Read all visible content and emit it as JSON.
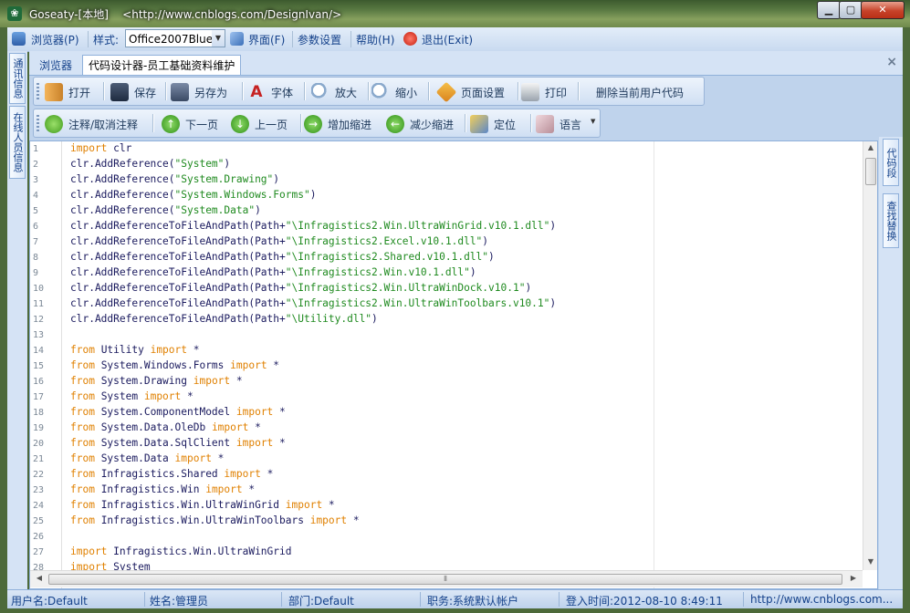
{
  "window": {
    "title": "Goseaty-[本地]    <http://www.cnblogs.com/DesignIvan/>",
    "minimize_glyph": "▁",
    "maximize_glyph": "▢",
    "close_glyph": "✕"
  },
  "menubar": {
    "browser": "浏览器(P)",
    "style_label": "样式:",
    "style_value": "Office2007Blue",
    "interface": "界面(F)",
    "params": "参数设置",
    "help": "帮助(H)",
    "exit": "退出(Exit)"
  },
  "left_tabs": [
    "通讯信息",
    "在线人员信息"
  ],
  "right_tabs": [
    "代码段",
    "查找替换"
  ],
  "doc_tabs": {
    "tabs": [
      "浏览器",
      "代码设计器-员工基础资料维护"
    ],
    "active_index": 1,
    "close_glyph": "×"
  },
  "toolbar1": {
    "open": "打开",
    "save": "保存",
    "save_as": "另存为",
    "font": "字体",
    "zoom_in": "放大",
    "zoom_out": "缩小",
    "page_setup": "页面设置",
    "print": "打印",
    "delete_user_code": "删除当前用户代码"
  },
  "toolbar2": {
    "comment": "注释/取消注释",
    "next_page": "下一页",
    "prev_page": "上一页",
    "indent": "增加缩进",
    "outdent": "减少缩进",
    "locate": "定位",
    "language": "语言"
  },
  "editor": {
    "line_numbers": [
      "1",
      "2",
      "3",
      "4",
      "5",
      "6",
      "7",
      "8",
      "9",
      "10",
      "11",
      "12",
      "13",
      "14",
      "15",
      "16",
      "17",
      "18",
      "19",
      "20",
      "21",
      "22",
      "23",
      "24",
      "25",
      "26",
      "27",
      "28"
    ],
    "lines": [
      [
        {
          "t": "import",
          "k": "kw"
        },
        {
          "t": " clr"
        }
      ],
      [
        {
          "t": "clr.AddReference("
        },
        {
          "t": "\"System\"",
          "k": "str"
        },
        {
          "t": ")"
        }
      ],
      [
        {
          "t": "clr.AddReference("
        },
        {
          "t": "\"System.Drawing\"",
          "k": "str"
        },
        {
          "t": ")"
        }
      ],
      [
        {
          "t": "clr.AddReference("
        },
        {
          "t": "\"System.Windows.Forms\"",
          "k": "str"
        },
        {
          "t": ")"
        }
      ],
      [
        {
          "t": "clr.AddReference("
        },
        {
          "t": "\"System.Data\"",
          "k": "str"
        },
        {
          "t": ")"
        }
      ],
      [
        {
          "t": "clr.AddReferenceToFileAndPath(Path+"
        },
        {
          "t": "\"\\Infragistics2.Win.UltraWinGrid.v10.1.dll\"",
          "k": "str"
        },
        {
          "t": ")"
        }
      ],
      [
        {
          "t": "clr.AddReferenceToFileAndPath(Path+"
        },
        {
          "t": "\"\\Infragistics2.Excel.v10.1.dll\"",
          "k": "str"
        },
        {
          "t": ")"
        }
      ],
      [
        {
          "t": "clr.AddReferenceToFileAndPath(Path+"
        },
        {
          "t": "\"\\Infragistics2.Shared.v10.1.dll\"",
          "k": "str"
        },
        {
          "t": ")"
        }
      ],
      [
        {
          "t": "clr.AddReferenceToFileAndPath(Path+"
        },
        {
          "t": "\"\\Infragistics2.Win.v10.1.dll\"",
          "k": "str"
        },
        {
          "t": ")"
        }
      ],
      [
        {
          "t": "clr.AddReferenceToFileAndPath(Path+"
        },
        {
          "t": "\"\\Infragistics2.Win.UltraWinDock.v10.1\"",
          "k": "str"
        },
        {
          "t": ")"
        }
      ],
      [
        {
          "t": "clr.AddReferenceToFileAndPath(Path+"
        },
        {
          "t": "\"\\Infragistics2.Win.UltraWinToolbars.v10.1\"",
          "k": "str"
        },
        {
          "t": ")"
        }
      ],
      [
        {
          "t": "clr.AddReferenceToFileAndPath(Path+"
        },
        {
          "t": "\"\\Utility.dll\"",
          "k": "str"
        },
        {
          "t": ")"
        }
      ],
      [],
      [
        {
          "t": "from",
          "k": "kw"
        },
        {
          "t": " Utility "
        },
        {
          "t": "import",
          "k": "kw"
        },
        {
          "t": " *"
        }
      ],
      [
        {
          "t": "from",
          "k": "kw"
        },
        {
          "t": " System.Windows.Forms "
        },
        {
          "t": "import",
          "k": "kw"
        },
        {
          "t": " *"
        }
      ],
      [
        {
          "t": "from",
          "k": "kw"
        },
        {
          "t": " System.Drawing "
        },
        {
          "t": "import",
          "k": "kw"
        },
        {
          "t": " *"
        }
      ],
      [
        {
          "t": "from",
          "k": "kw"
        },
        {
          "t": " System "
        },
        {
          "t": "import",
          "k": "kw"
        },
        {
          "t": " *"
        }
      ],
      [
        {
          "t": "from",
          "k": "kw"
        },
        {
          "t": " System.ComponentModel "
        },
        {
          "t": "import",
          "k": "kw"
        },
        {
          "t": " *"
        }
      ],
      [
        {
          "t": "from",
          "k": "kw"
        },
        {
          "t": " System.Data.OleDb "
        },
        {
          "t": "import",
          "k": "kw"
        },
        {
          "t": " *"
        }
      ],
      [
        {
          "t": "from",
          "k": "kw"
        },
        {
          "t": " System.Data.SqlClient "
        },
        {
          "t": "import",
          "k": "kw"
        },
        {
          "t": " *"
        }
      ],
      [
        {
          "t": "from",
          "k": "kw"
        },
        {
          "t": " System.Data "
        },
        {
          "t": "import",
          "k": "kw"
        },
        {
          "t": " *"
        }
      ],
      [
        {
          "t": "from",
          "k": "kw"
        },
        {
          "t": " Infragistics.Shared "
        },
        {
          "t": "import",
          "k": "kw"
        },
        {
          "t": " *"
        }
      ],
      [
        {
          "t": "from",
          "k": "kw"
        },
        {
          "t": " Infragistics.Win "
        },
        {
          "t": "import",
          "k": "kw"
        },
        {
          "t": " *"
        }
      ],
      [
        {
          "t": "from",
          "k": "kw"
        },
        {
          "t": " Infragistics.Win.UltraWinGrid "
        },
        {
          "t": "import",
          "k": "kw"
        },
        {
          "t": " *"
        }
      ],
      [
        {
          "t": "from",
          "k": "kw"
        },
        {
          "t": " Infragistics.Win.UltraWinToolbars "
        },
        {
          "t": "import",
          "k": "kw"
        },
        {
          "t": " *"
        }
      ],
      [],
      [
        {
          "t": "import",
          "k": "kw"
        },
        {
          "t": " Infragistics.Win.UltraWinGrid"
        }
      ],
      [
        {
          "t": "import",
          "k": "kw"
        },
        {
          "t": " System"
        }
      ]
    ]
  },
  "statusbar": {
    "user": "用户名:Default",
    "name": "姓名:管理员",
    "dept": "部门:Default",
    "role": "职务:系统默认帐户",
    "login": "登入时间:2012-08-10 8:49:11",
    "url": "http://www.cnblogs.com..."
  },
  "colors": {
    "keyword": "#e08000",
    "string": "#1f8a1f",
    "accent": "#15428b"
  }
}
